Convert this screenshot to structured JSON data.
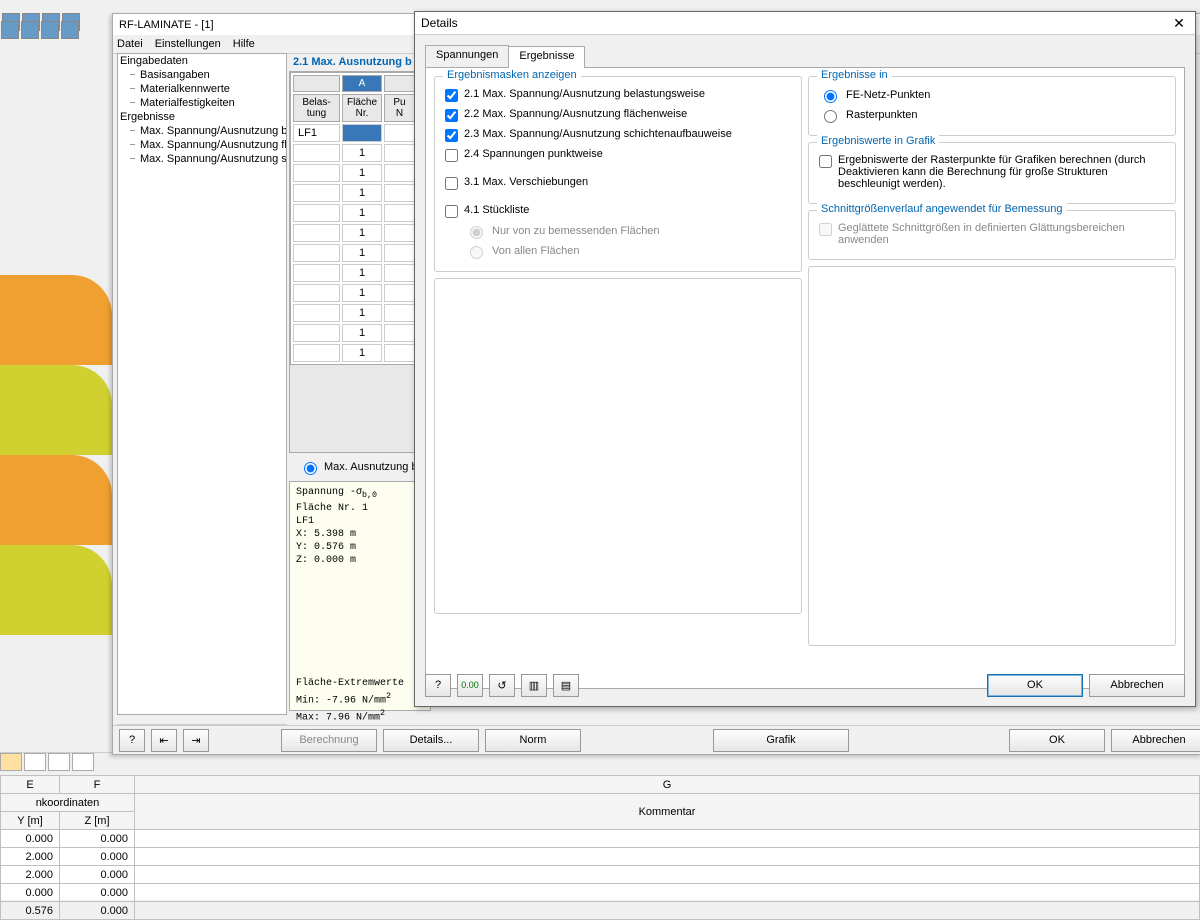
{
  "mainWin": {
    "title": "RF-LAMINATE - [1]",
    "menu": [
      "Datei",
      "Einstellungen",
      "Hilfe"
    ]
  },
  "tree": {
    "g1": "Eingabedaten",
    "i1": "Basisangaben",
    "i2": "Materialkennwerte",
    "i3": "Materialfestigkeiten",
    "g2": "Ergebnisse",
    "i4": "Max. Spannung/Ausnutzung be",
    "i5": "Max. Spannung/Ausnutzung flä",
    "i6": "Max. Spannung/Ausnutzung sc"
  },
  "section": {
    "header": "2.1 Max. Ausnutzung b",
    "h1": "Belas-\ntung",
    "h2": "Fläche\nNr.",
    "h3": "Pu\nN",
    "colA": "A",
    "lf": "LF1",
    "rows": [
      "1",
      "1",
      "1",
      "1",
      "1",
      "1",
      "1",
      "1",
      "1",
      "1",
      "1"
    ]
  },
  "radio": {
    "r": "Max. Ausnutzung b"
  },
  "info": {
    "l1": "Spannung -σ",
    "sub": "b,0",
    "l2": "Fläche Nr. 1",
    "l3": "LF1",
    "l4": "X: 5.398 m",
    "l5": "Y: 0.576 m",
    "l6": "Z: 0.000 m",
    "l7": "Fläche-Extremwerte",
    "l8": "Min: -7.96 N/mm",
    "l9": "Max:  7.96 N/mm"
  },
  "btm": {
    "ber": "Berechnung",
    "det": "Details...",
    "norm": "Norm",
    "grafik": "Grafik",
    "ok": "OK",
    "abbr": "Abbrechen"
  },
  "dlg": {
    "title": "Details",
    "tab1": "Spannungen",
    "tab2": "Ergebnisse",
    "fs1": "Ergebnismasken anzeigen",
    "c1": "2.1 Max. Spannung/Ausnutzung belastungsweise",
    "c2": "2.2 Max. Spannung/Ausnutzung flächenweise",
    "c3": "2.3 Max. Spannung/Ausnutzung schichtenaufbauweise",
    "c4": "2.4 Spannungen punktweise",
    "c5": "3.1 Max. Verschiebungen",
    "c6": "4.1 Stückliste",
    "r1": "Nur von zu bemessenden Flächen",
    "r2": "Von allen Flächen",
    "fs2": "Ergebnisse in",
    "r3": "FE-Netz-Punkten",
    "r4": "Rasterpunkten",
    "fs3": "Ergebniswerte in Grafik",
    "c7": "Ergebniswerte der Rasterpunkte für Grafiken berechnen (durch Deaktivieren kann die Berechnung für große Strukturen beschleunigt werden).",
    "fs4": "Schnittgrößenverlauf angewendet für Bemessung",
    "c8": "Geglättete Schnittgrößen in definierten Glättungsbereichen anwenden",
    "ok": "OK",
    "abbr": "Abbrechen"
  },
  "sheet": {
    "cE": "E",
    "cF": "F",
    "cG": "G",
    "h1": "nkoordinaten",
    "hY": "Y [m]",
    "hZ": "Z [m]",
    "hK": "Kommentar",
    "rows": [
      [
        "0.000",
        "0.000"
      ],
      [
        "2.000",
        "0.000"
      ],
      [
        "2.000",
        "0.000"
      ],
      [
        "0.000",
        "0.000"
      ],
      [
        "0.576",
        "0.000"
      ]
    ]
  }
}
